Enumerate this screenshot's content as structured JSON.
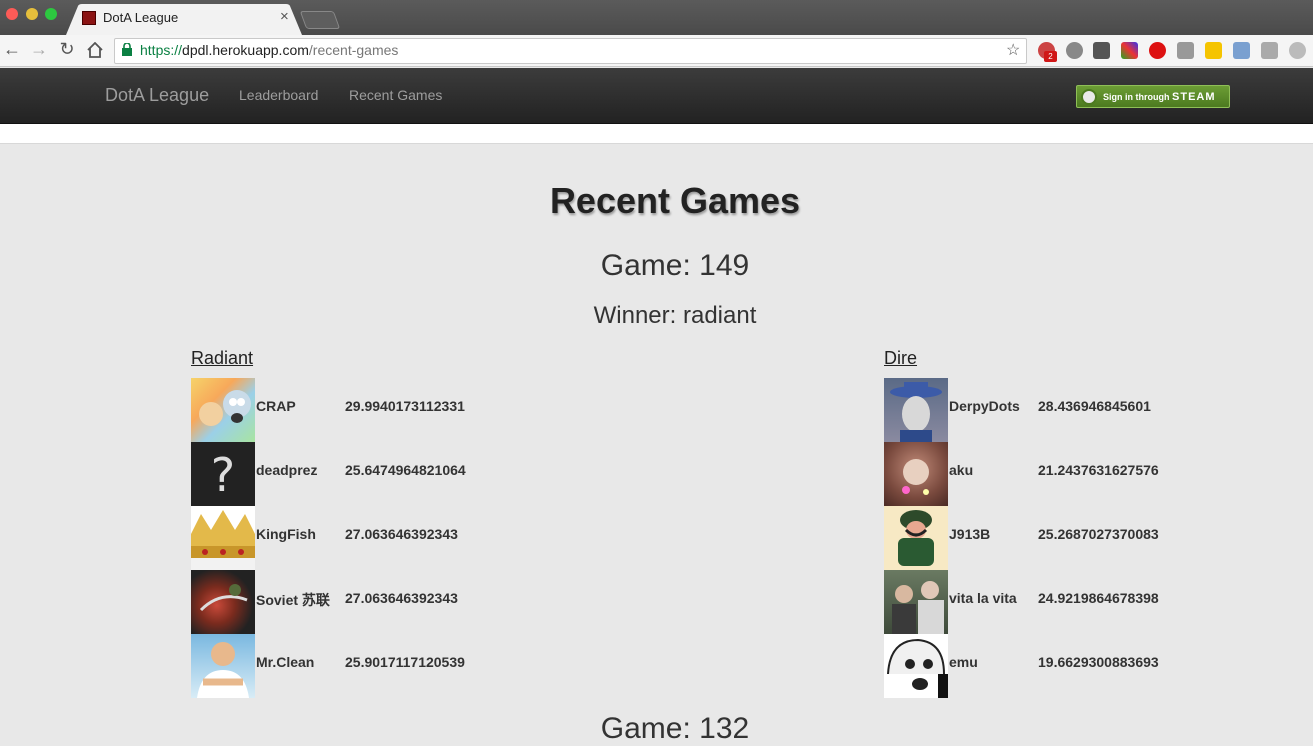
{
  "browser": {
    "tab_title": "DotA League",
    "tab_close": "×",
    "url_scheme": "https://",
    "url_host": "dpdl.herokuapp.com",
    "url_path": "/recent-games",
    "extension_badge": "2",
    "bookmark_star": "☆"
  },
  "navbar": {
    "brand": "DotA League",
    "links": [
      "Leaderboard",
      "Recent Games"
    ],
    "steam_prefix": "Sign in through",
    "steam_word": "STEAM"
  },
  "page": {
    "title": "Recent Games",
    "game": "Game: 149",
    "winner": "Winner: radiant",
    "next_game": "Game: 132"
  },
  "radiant": {
    "heading": "Radiant",
    "players": [
      {
        "name": "CRAP",
        "rating": "29.9940173112331",
        "avatar": "cartoon-characters-avatar"
      },
      {
        "name": "deadprez",
        "rating": "25.6474964821064",
        "avatar": "question-mark-avatar"
      },
      {
        "name": "KingFish",
        "rating": "27.063646392343",
        "avatar": "crown-avatar"
      },
      {
        "name": "Soviet 苏联",
        "rating": "27.063646392343",
        "avatar": "monster-avatar"
      },
      {
        "name": "Mr.Clean",
        "rating": "25.9017117120539",
        "avatar": "mr-clean-avatar"
      }
    ]
  },
  "dire": {
    "heading": "Dire",
    "players": [
      {
        "name": "DerpyDots",
        "rating": "28.436946845601",
        "avatar": "hat-character-avatar"
      },
      {
        "name": "aku",
        "rating": "21.2437631627576",
        "avatar": "cat-avatar"
      },
      {
        "name": "J913B",
        "rating": "25.2687027370083",
        "avatar": "soldier-avatar"
      },
      {
        "name": "vita la vita",
        "rating": "24.9219864678398",
        "avatar": "two-men-avatar"
      },
      {
        "name": "emu",
        "rating": "19.6629300883693",
        "avatar": "anime-avatar"
      }
    ]
  }
}
